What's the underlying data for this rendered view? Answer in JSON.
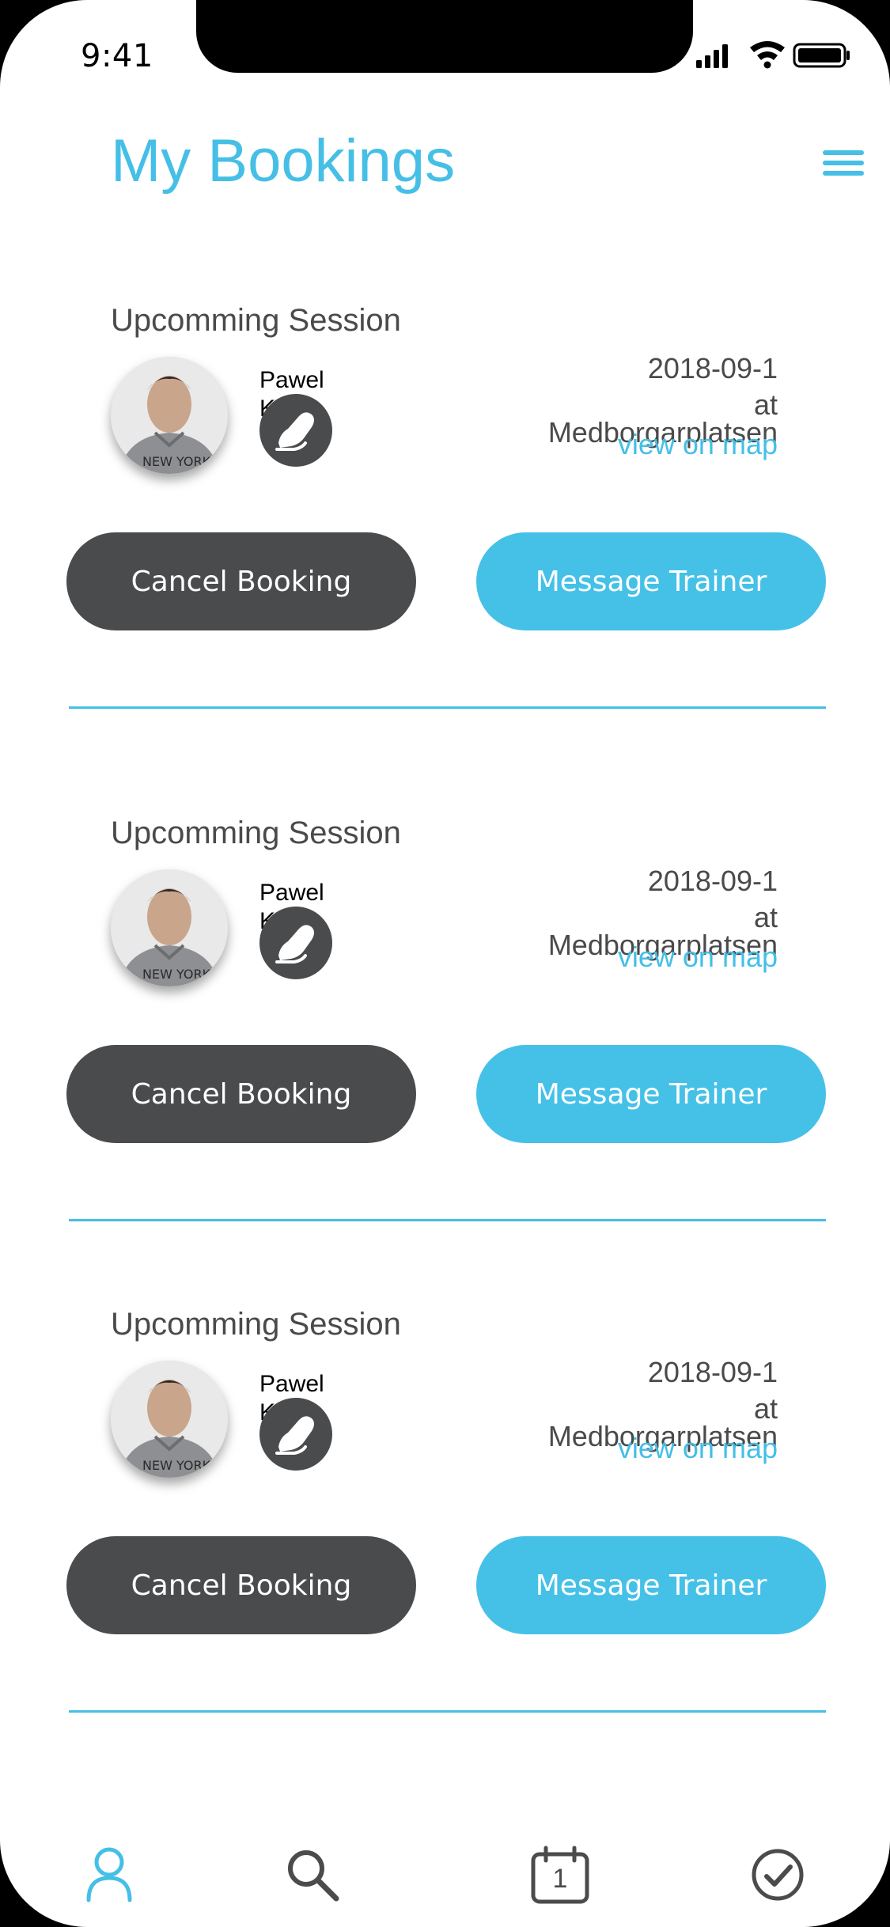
{
  "status_bar": {
    "time": "9:41"
  },
  "header": {
    "title": "My Bookings"
  },
  "bookings": [
    {
      "heading": "Upcomming Session",
      "trainer_name": "Pawel Krupa",
      "date": "2018-09-1",
      "at": "at",
      "location": "Medborgarplatsen",
      "view_map": "view on map",
      "cancel_label": "Cancel Booking",
      "message_label": "Message Trainer"
    },
    {
      "heading": "Upcomming Session",
      "trainer_name": "Pawel Krupa",
      "date": "2018-09-1",
      "at": "at",
      "location": "Medborgarplatsen",
      "view_map": "view on map",
      "cancel_label": "Cancel Booking",
      "message_label": "Message Trainer"
    },
    {
      "heading": "Upcomming Session",
      "trainer_name": "Pawel Krupa",
      "date": "2018-09-1",
      "at": "at",
      "location": "Medborgarplatsen",
      "view_map": "view on map",
      "cancel_label": "Cancel Booking",
      "message_label": "Message Trainer"
    }
  ],
  "tab_bar": {
    "calendar_day": "1",
    "icons": [
      "profile-icon",
      "search-icon",
      "calendar-icon",
      "check-circle-icon"
    ]
  },
  "colors": {
    "accent": "#45bfe6",
    "dark_button": "#4a4b4d",
    "text": "#4a4a4a"
  }
}
